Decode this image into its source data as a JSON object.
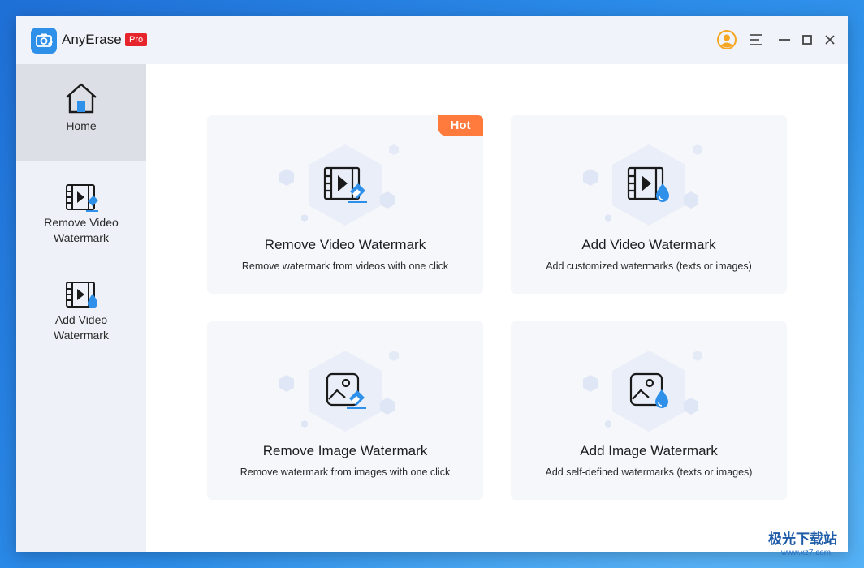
{
  "app": {
    "name": "AnyErase",
    "badge": "Pro"
  },
  "sidebar": {
    "items": [
      {
        "label": "Home",
        "icon": "home-icon",
        "active": true
      },
      {
        "label": "Remove Video Watermark",
        "line1": "Remove Video",
        "line2": "Watermark",
        "icon": "video-eraser-icon"
      },
      {
        "label": "Add Video Watermark",
        "line1": "Add Video",
        "line2": "Watermark",
        "icon": "video-drop-icon"
      }
    ]
  },
  "cards": [
    {
      "title": "Remove Video Watermark",
      "desc": "Remove watermark from videos with one click",
      "badge": "Hot",
      "icon": "video-eraser-icon"
    },
    {
      "title": "Add Video Watermark",
      "desc": "Add customized watermarks (texts or images)",
      "icon": "video-drop-icon"
    },
    {
      "title": "Remove Image Watermark",
      "desc": "Remove watermark from images with one click",
      "icon": "image-eraser-icon"
    },
    {
      "title": "Add Image Watermark",
      "desc": "Add self-defined watermarks  (texts or images)",
      "icon": "image-drop-icon"
    }
  ],
  "site_watermark": {
    "text": "极光下载站",
    "url": "www.xz7.com"
  },
  "colors": {
    "accent": "#2f90ea",
    "pro": "#e5242b",
    "hot": "#ff7a3d",
    "user": "#f5a623"
  }
}
